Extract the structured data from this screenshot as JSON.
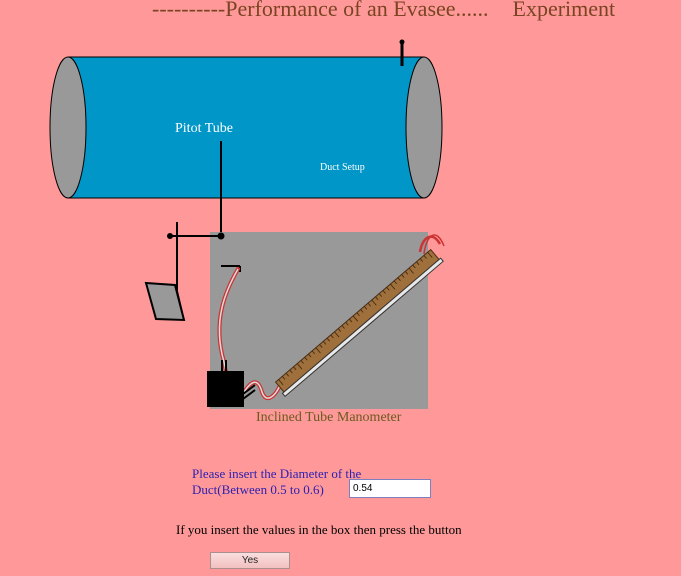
{
  "title": {
    "main": "----------Performance of an Evasee......",
    "suffix": "Experiment"
  },
  "diagram": {
    "pitot_label": "Pitot Tube",
    "duct_label": "Duct Setup",
    "manometer_label": "Inclined Tube Manometer",
    "colors": {
      "duct_body": "#0096c8",
      "duct_end": "#999999",
      "panel": "#999999",
      "scale": "#a0703c",
      "tube": "#cc3333"
    }
  },
  "form": {
    "prompt": "Please insert the Diameter of the Duct(Between 0.5 to 0.6)",
    "diameter_value": "0.54",
    "note": "If you insert the values in the box then press the button",
    "button_label": "Yes"
  }
}
